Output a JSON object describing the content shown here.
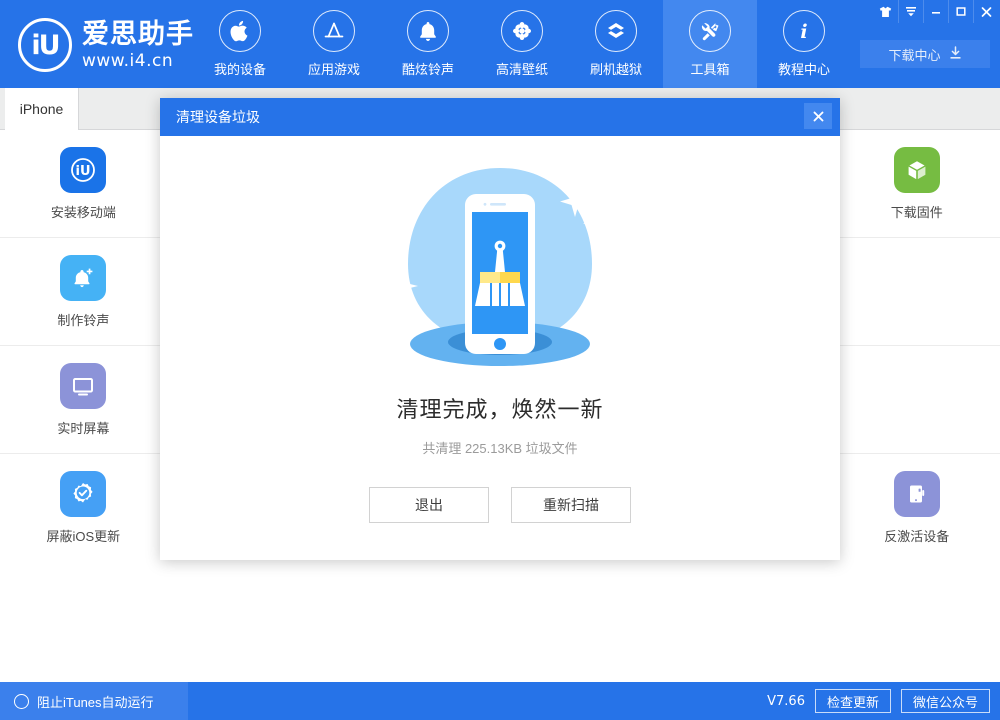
{
  "app": {
    "logo_mark": "iU",
    "logo_name": "爱思助手",
    "logo_url": "www.i4.cn"
  },
  "nav": {
    "items": [
      {
        "label": "我的设备",
        "icon": "apple-icon",
        "active": false
      },
      {
        "label": "应用游戏",
        "icon": "appstore-icon",
        "active": false
      },
      {
        "label": "酷炫铃声",
        "icon": "bell-icon",
        "active": false
      },
      {
        "label": "高清壁纸",
        "icon": "flower-icon",
        "active": false
      },
      {
        "label": "刷机越狱",
        "icon": "box-icon",
        "active": false
      },
      {
        "label": "工具箱",
        "icon": "tools-icon",
        "active": true
      },
      {
        "label": "教程中心",
        "icon": "info-icon",
        "active": false
      }
    ],
    "download_center": "下载中心",
    "download_center_icon": "download-icon"
  },
  "window_controls": [
    {
      "name": "skin-icon",
      "glyph": "👕"
    },
    {
      "name": "menu-icon",
      "glyph": "▼"
    },
    {
      "name": "minimize-icon",
      "glyph": "–"
    },
    {
      "name": "maximize-icon",
      "glyph": "□"
    },
    {
      "name": "close-icon",
      "glyph": "✕"
    }
  ],
  "tabstrip": {
    "tab_label": "iPhone"
  },
  "grid": {
    "rows": [
      [
        {
          "label": "安装移动端",
          "icon": "iu-app-icon",
          "color": "#1a73e8"
        },
        {
          "label": "",
          "icon": "",
          "color": ""
        },
        {
          "label": "",
          "icon": "",
          "color": ""
        },
        {
          "label": "",
          "icon": "",
          "color": ""
        },
        {
          "label": "",
          "icon": "",
          "color": ""
        },
        {
          "label": "下载固件",
          "icon": "cube-icon",
          "color": "#76bc42"
        }
      ],
      [
        {
          "label": "制作铃声",
          "icon": "bell-plus-icon",
          "color": "#45b2f5"
        },
        {
          "label": "",
          "icon": "",
          "color": ""
        },
        {
          "label": "",
          "icon": "",
          "color": ""
        },
        {
          "label": "",
          "icon": "",
          "color": ""
        },
        {
          "label": "",
          "icon": "",
          "color": ""
        },
        {
          "label": "",
          "icon": "",
          "color": ""
        }
      ],
      [
        {
          "label": "实时屏幕",
          "icon": "monitor-icon",
          "color": "#8c93d8"
        },
        {
          "label": "",
          "icon": "",
          "color": ""
        },
        {
          "label": "",
          "icon": "",
          "color": ""
        },
        {
          "label": "",
          "icon": "",
          "color": ""
        },
        {
          "label": "",
          "icon": "",
          "color": ""
        },
        {
          "label": "",
          "icon": "",
          "color": ""
        }
      ],
      [
        {
          "label": "屏蔽iOS更新",
          "icon": "gear-shield-icon",
          "color": "#45a0f5"
        },
        {
          "label": "",
          "icon": "",
          "color": ""
        },
        {
          "label": "",
          "icon": "",
          "color": ""
        },
        {
          "label": "",
          "icon": "",
          "color": ""
        },
        {
          "label": "",
          "icon": "",
          "color": ""
        },
        {
          "label": "反激活设备",
          "icon": "device-icon",
          "color": "#8c93d8"
        }
      ]
    ]
  },
  "dialog": {
    "title": "清理设备垃圾",
    "close_icon": "close-icon",
    "illustration": "phone-broom-clean-illustration",
    "result_title": "清理完成，焕然一新",
    "result_subtitle": "共清理 225.13KB 垃圾文件",
    "buttons": [
      {
        "label": "退出",
        "name": "exit-button"
      },
      {
        "label": "重新扫描",
        "name": "rescan-button"
      }
    ]
  },
  "statusbar": {
    "itunes_toggle_label": "阻止iTunes自动运行",
    "version": "V7.66",
    "check_update": "检查更新",
    "wechat": "微信公众号"
  },
  "colors": {
    "brand_blue": "#2673e8",
    "nav_active": "#4388ef",
    "illus_blob": "#a8d8fb"
  }
}
